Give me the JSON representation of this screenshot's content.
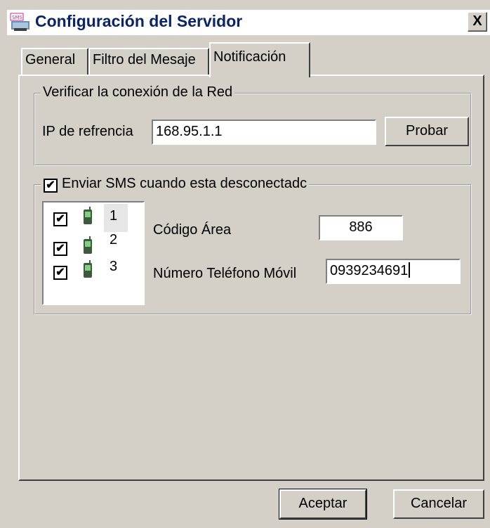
{
  "window": {
    "title": "Configuración del Servidor",
    "close_label": "X"
  },
  "tabs": [
    {
      "label": "General",
      "active": false
    },
    {
      "label": "Filtro del Mesaje",
      "active": false
    },
    {
      "label": "Notificación",
      "active": true
    }
  ],
  "network": {
    "group_label": "Verificar la conexión de la Red",
    "ip_label": "IP de refrencia",
    "ip_value": "168.95.1.1",
    "test_button": "Probar"
  },
  "sms": {
    "enable_label": "Enviar SMS cuando esta desconectadc",
    "enabled": true,
    "devices": [
      {
        "number": "1",
        "checked": true,
        "icon": "mobile-phone-icon"
      },
      {
        "number": "2",
        "checked": true,
        "icon": "mobile-phone-icon"
      },
      {
        "number": "3",
        "checked": true,
        "icon": "mobile-phone-icon"
      }
    ],
    "area_code_label": "Código Área",
    "area_code_value": "886",
    "mobile_label": "Número Teléfono Móvil",
    "mobile_value": "0939234691"
  },
  "footer": {
    "accept": "Aceptar",
    "cancel": "Cancelar"
  },
  "colors": {
    "title_text": "#0a246a",
    "face": "#d4d0c8"
  }
}
